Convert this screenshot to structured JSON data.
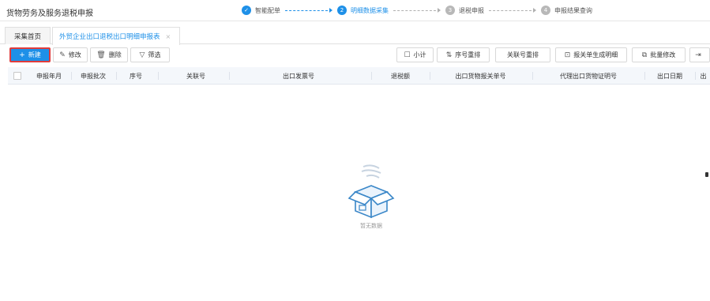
{
  "app": {
    "title": "货物劳务及服务退税申报"
  },
  "steps": [
    {
      "num": "✓",
      "label": "智能配单",
      "state": "done"
    },
    {
      "num": "2",
      "label": "明细数据采集",
      "state": "current"
    },
    {
      "num": "3",
      "label": "退税申报",
      "state": "todo"
    },
    {
      "num": "4",
      "label": "申报结果查询",
      "state": "todo"
    }
  ],
  "tabs": {
    "home": "采集首页",
    "active": "外贸企业出口退税出口明细申报表",
    "close": "×"
  },
  "toolbar": {
    "new_label": "新建",
    "edit_label": "修改",
    "delete_label": "删除",
    "filter_label": "筛选",
    "subtotal_label": "小计",
    "seq_reorder_label": "序号重排",
    "rel_reorder_label": "关联号重排",
    "gen_detail_label": "报关单生成明细",
    "batch_edit_label": "批量修改",
    "more_label": ""
  },
  "table": {
    "columns": [
      "申报年月",
      "申报批次",
      "序号",
      "关联号",
      "出口发票号",
      "退税额",
      "出口货物报关单号",
      "代理出口货物证明号",
      "出口日期",
      "出"
    ]
  },
  "empty": {
    "text": "暂无数据"
  },
  "colors": {
    "accent": "#1e90e8",
    "highlight_border": "#e03b3b"
  }
}
